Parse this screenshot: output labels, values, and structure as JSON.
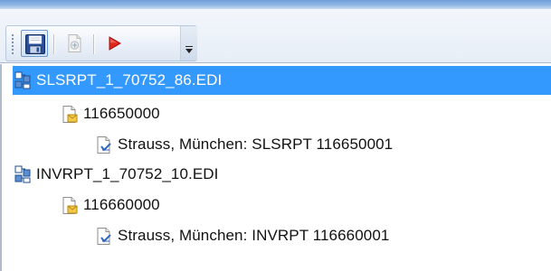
{
  "toolbar": {
    "buttons": [
      {
        "icon": "save-icon",
        "state": "pressed"
      },
      {
        "icon": "add-document-icon",
        "state": "disabled"
      },
      {
        "icon": "run-icon",
        "state": "enabled"
      }
    ]
  },
  "tree": {
    "nodes": [
      {
        "label": "SLSRPT_1_70752_86.EDI",
        "level": 0,
        "icon": "interchange-icon",
        "selected": true
      },
      {
        "label": "116650000",
        "level": 1,
        "icon": "group-document-icon",
        "selected": false
      },
      {
        "label": "Strauss, München: SLSRPT 116650001",
        "level": 2,
        "icon": "message-document-icon",
        "selected": false
      },
      {
        "label": "INVRPT_1_70752_10.EDI",
        "level": 0,
        "icon": "interchange-icon",
        "selected": false
      },
      {
        "label": "116660000",
        "level": 1,
        "icon": "group-document-icon",
        "selected": false
      },
      {
        "label": "Strauss, München: INVRPT 116660001",
        "level": 2,
        "icon": "message-document-icon",
        "selected": false
      }
    ]
  },
  "colors": {
    "selection": "#3399ff",
    "run_red": "#e0251b",
    "save_blue": "#2a4f9a"
  }
}
